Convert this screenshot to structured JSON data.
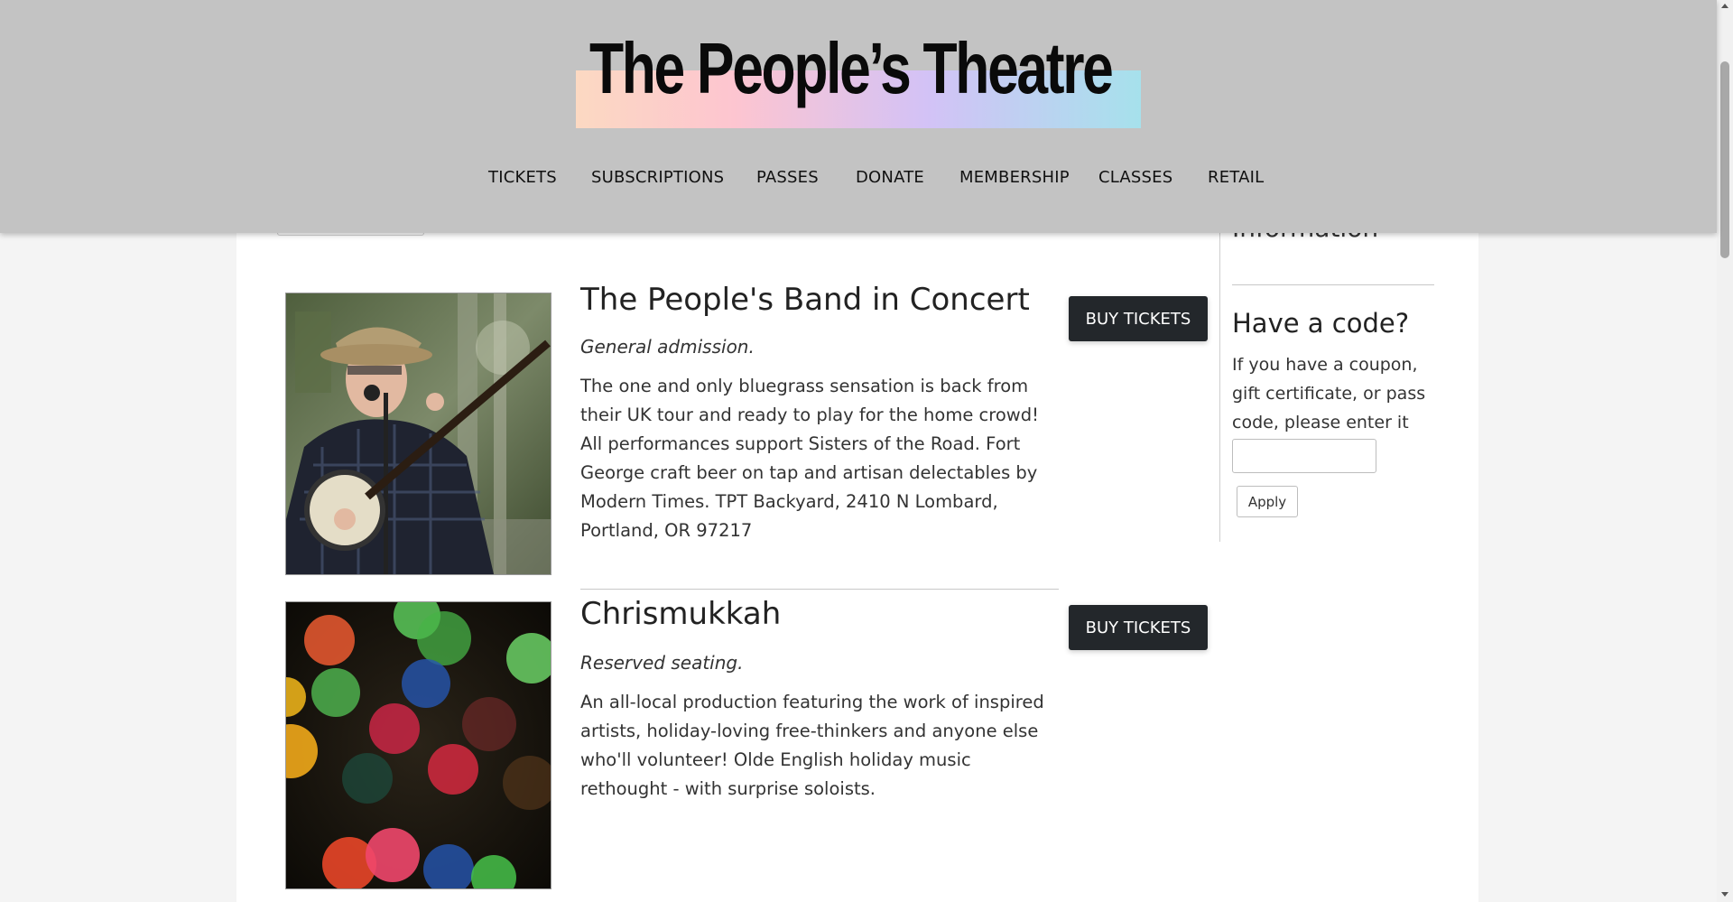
{
  "header": {
    "logo_text": "The People’s Theatre",
    "nav": [
      "TICKETS",
      "SUBSCRIPTIONS",
      "PASSES",
      "DONATE",
      "MEMBERSHIP",
      "CLASSES",
      "RETAIL"
    ]
  },
  "events": [
    {
      "title": "The People's Band in Concert",
      "subtitle": "General admission.",
      "description": "The one and only bluegrass sensation is back from their UK tour and ready to play for the home crowd! All performances support Sisters of the Road. Fort George craft beer on tap and artisan delectables by Modern Times. TPT Backyard, 2410 N Lombard, Portland, OR 97217",
      "button_label": "BUY TICKETS",
      "image": "banjo-player-photo"
    },
    {
      "title": "Chrismukkah",
      "subtitle": "Reserved seating.",
      "description": "An all-local production featuring the work of inspired artists, holiday-loving free-thinkers and anyone else who'll volunteer!  Olde English holiday music rethought  - with surprise soloists.",
      "button_label": "BUY TICKETS",
      "image": "colorful-bokeh-lights-photo"
    }
  ],
  "sidebar": {
    "info_heading": "Information",
    "code_title": "Have a code?",
    "code_text": "If you have a coupon, gift certificate, or pass code, please enter it here:",
    "code_input_value": "",
    "apply_label": "Apply"
  },
  "colors": {
    "header_bg": "#c3c3c3",
    "button_bg": "#23272b",
    "page_bg": "#f4f4f4"
  }
}
